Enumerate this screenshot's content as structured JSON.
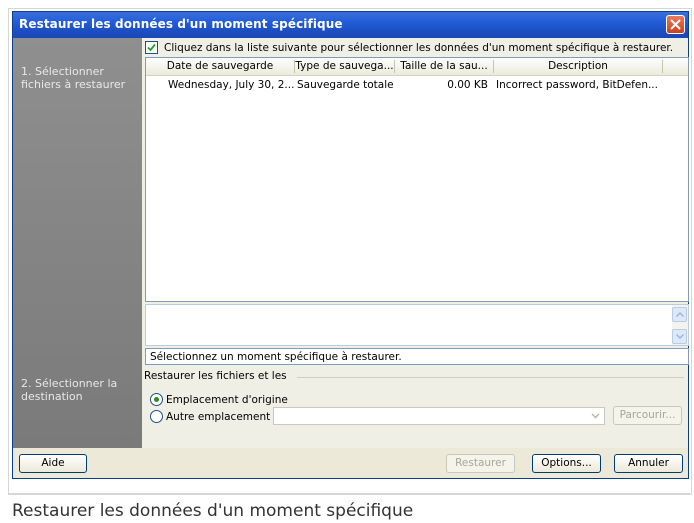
{
  "window": {
    "title": "Restaurer les données d'un moment spécifique"
  },
  "sidebar": {
    "step1": "1. Sélectionner fichiers à restaurer",
    "step2": "2. Sélectionner la destination"
  },
  "instruction": "Cliquez dans la liste suivante pour sélectionner les données d'un moment spécifique à restaurer.",
  "table": {
    "columns": [
      "Date de sauvegarde",
      "Type de sauvega...",
      "Taille de la sau...",
      "Description"
    ],
    "rows": [
      [
        "Wednesday, July 30, 2...",
        "Sauvegarde totale",
        "0.00 KB",
        "Incorrect password, BitDefen..."
      ]
    ]
  },
  "status_text": "Sélectionnez un moment spécifique à restaurer.",
  "restore": {
    "label": "Restaurer les fichiers et les",
    "option_original": "Emplacement d'origine",
    "option_other": "Autre emplacement :",
    "browse_label": "Parcourir..."
  },
  "buttons": {
    "help": "Aide",
    "restore": "Restaurer",
    "options": "Options...",
    "cancel": "Annuler"
  },
  "caption": "Restaurer les données d'un moment spécifique"
}
